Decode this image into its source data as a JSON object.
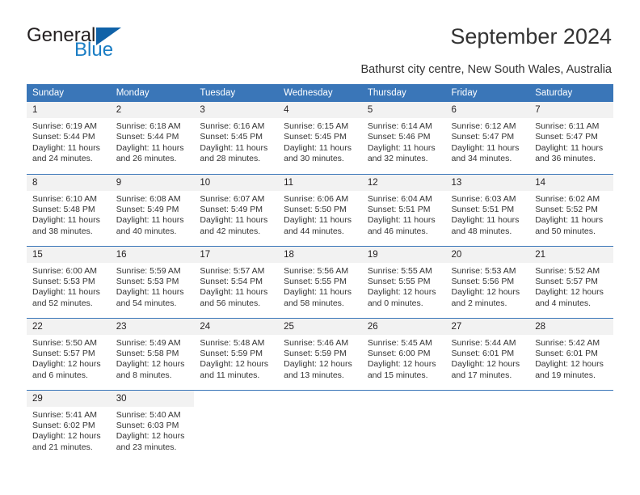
{
  "brand": {
    "name_top": "General",
    "name_bottom": "Blue",
    "accent_color": "#1062a8",
    "text_color": "#231f20"
  },
  "header": {
    "title": "September 2024",
    "location": "Bathurst city centre, New South Wales, Australia"
  },
  "theme": {
    "header_bg": "#3a76b8",
    "daynum_bg": "#f2f2f2",
    "body_text": "#333333"
  },
  "weekdays": [
    "Sunday",
    "Monday",
    "Tuesday",
    "Wednesday",
    "Thursday",
    "Friday",
    "Saturday"
  ],
  "weeks": [
    [
      {
        "day": "1",
        "sunrise": "Sunrise: 6:19 AM",
        "sunset": "Sunset: 5:44 PM",
        "daylight_l1": "Daylight: 11 hours",
        "daylight_l2": "and 24 minutes."
      },
      {
        "day": "2",
        "sunrise": "Sunrise: 6:18 AM",
        "sunset": "Sunset: 5:44 PM",
        "daylight_l1": "Daylight: 11 hours",
        "daylight_l2": "and 26 minutes."
      },
      {
        "day": "3",
        "sunrise": "Sunrise: 6:16 AM",
        "sunset": "Sunset: 5:45 PM",
        "daylight_l1": "Daylight: 11 hours",
        "daylight_l2": "and 28 minutes."
      },
      {
        "day": "4",
        "sunrise": "Sunrise: 6:15 AM",
        "sunset": "Sunset: 5:45 PM",
        "daylight_l1": "Daylight: 11 hours",
        "daylight_l2": "and 30 minutes."
      },
      {
        "day": "5",
        "sunrise": "Sunrise: 6:14 AM",
        "sunset": "Sunset: 5:46 PM",
        "daylight_l1": "Daylight: 11 hours",
        "daylight_l2": "and 32 minutes."
      },
      {
        "day": "6",
        "sunrise": "Sunrise: 6:12 AM",
        "sunset": "Sunset: 5:47 PM",
        "daylight_l1": "Daylight: 11 hours",
        "daylight_l2": "and 34 minutes."
      },
      {
        "day": "7",
        "sunrise": "Sunrise: 6:11 AM",
        "sunset": "Sunset: 5:47 PM",
        "daylight_l1": "Daylight: 11 hours",
        "daylight_l2": "and 36 minutes."
      }
    ],
    [
      {
        "day": "8",
        "sunrise": "Sunrise: 6:10 AM",
        "sunset": "Sunset: 5:48 PM",
        "daylight_l1": "Daylight: 11 hours",
        "daylight_l2": "and 38 minutes."
      },
      {
        "day": "9",
        "sunrise": "Sunrise: 6:08 AM",
        "sunset": "Sunset: 5:49 PM",
        "daylight_l1": "Daylight: 11 hours",
        "daylight_l2": "and 40 minutes."
      },
      {
        "day": "10",
        "sunrise": "Sunrise: 6:07 AM",
        "sunset": "Sunset: 5:49 PM",
        "daylight_l1": "Daylight: 11 hours",
        "daylight_l2": "and 42 minutes."
      },
      {
        "day": "11",
        "sunrise": "Sunrise: 6:06 AM",
        "sunset": "Sunset: 5:50 PM",
        "daylight_l1": "Daylight: 11 hours",
        "daylight_l2": "and 44 minutes."
      },
      {
        "day": "12",
        "sunrise": "Sunrise: 6:04 AM",
        "sunset": "Sunset: 5:51 PM",
        "daylight_l1": "Daylight: 11 hours",
        "daylight_l2": "and 46 minutes."
      },
      {
        "day": "13",
        "sunrise": "Sunrise: 6:03 AM",
        "sunset": "Sunset: 5:51 PM",
        "daylight_l1": "Daylight: 11 hours",
        "daylight_l2": "and 48 minutes."
      },
      {
        "day": "14",
        "sunrise": "Sunrise: 6:02 AM",
        "sunset": "Sunset: 5:52 PM",
        "daylight_l1": "Daylight: 11 hours",
        "daylight_l2": "and 50 minutes."
      }
    ],
    [
      {
        "day": "15",
        "sunrise": "Sunrise: 6:00 AM",
        "sunset": "Sunset: 5:53 PM",
        "daylight_l1": "Daylight: 11 hours",
        "daylight_l2": "and 52 minutes."
      },
      {
        "day": "16",
        "sunrise": "Sunrise: 5:59 AM",
        "sunset": "Sunset: 5:53 PM",
        "daylight_l1": "Daylight: 11 hours",
        "daylight_l2": "and 54 minutes."
      },
      {
        "day": "17",
        "sunrise": "Sunrise: 5:57 AM",
        "sunset": "Sunset: 5:54 PM",
        "daylight_l1": "Daylight: 11 hours",
        "daylight_l2": "and 56 minutes."
      },
      {
        "day": "18",
        "sunrise": "Sunrise: 5:56 AM",
        "sunset": "Sunset: 5:55 PM",
        "daylight_l1": "Daylight: 11 hours",
        "daylight_l2": "and 58 minutes."
      },
      {
        "day": "19",
        "sunrise": "Sunrise: 5:55 AM",
        "sunset": "Sunset: 5:55 PM",
        "daylight_l1": "Daylight: 12 hours",
        "daylight_l2": "and 0 minutes."
      },
      {
        "day": "20",
        "sunrise": "Sunrise: 5:53 AM",
        "sunset": "Sunset: 5:56 PM",
        "daylight_l1": "Daylight: 12 hours",
        "daylight_l2": "and 2 minutes."
      },
      {
        "day": "21",
        "sunrise": "Sunrise: 5:52 AM",
        "sunset": "Sunset: 5:57 PM",
        "daylight_l1": "Daylight: 12 hours",
        "daylight_l2": "and 4 minutes."
      }
    ],
    [
      {
        "day": "22",
        "sunrise": "Sunrise: 5:50 AM",
        "sunset": "Sunset: 5:57 PM",
        "daylight_l1": "Daylight: 12 hours",
        "daylight_l2": "and 6 minutes."
      },
      {
        "day": "23",
        "sunrise": "Sunrise: 5:49 AM",
        "sunset": "Sunset: 5:58 PM",
        "daylight_l1": "Daylight: 12 hours",
        "daylight_l2": "and 8 minutes."
      },
      {
        "day": "24",
        "sunrise": "Sunrise: 5:48 AM",
        "sunset": "Sunset: 5:59 PM",
        "daylight_l1": "Daylight: 12 hours",
        "daylight_l2": "and 11 minutes."
      },
      {
        "day": "25",
        "sunrise": "Sunrise: 5:46 AM",
        "sunset": "Sunset: 5:59 PM",
        "daylight_l1": "Daylight: 12 hours",
        "daylight_l2": "and 13 minutes."
      },
      {
        "day": "26",
        "sunrise": "Sunrise: 5:45 AM",
        "sunset": "Sunset: 6:00 PM",
        "daylight_l1": "Daylight: 12 hours",
        "daylight_l2": "and 15 minutes."
      },
      {
        "day": "27",
        "sunrise": "Sunrise: 5:44 AM",
        "sunset": "Sunset: 6:01 PM",
        "daylight_l1": "Daylight: 12 hours",
        "daylight_l2": "and 17 minutes."
      },
      {
        "day": "28",
        "sunrise": "Sunrise: 5:42 AM",
        "sunset": "Sunset: 6:01 PM",
        "daylight_l1": "Daylight: 12 hours",
        "daylight_l2": "and 19 minutes."
      }
    ],
    [
      {
        "day": "29",
        "sunrise": "Sunrise: 5:41 AM",
        "sunset": "Sunset: 6:02 PM",
        "daylight_l1": "Daylight: 12 hours",
        "daylight_l2": "and 21 minutes."
      },
      {
        "day": "30",
        "sunrise": "Sunrise: 5:40 AM",
        "sunset": "Sunset: 6:03 PM",
        "daylight_l1": "Daylight: 12 hours",
        "daylight_l2": "and 23 minutes."
      },
      {
        "day": "",
        "sunrise": "",
        "sunset": "",
        "daylight_l1": "",
        "daylight_l2": ""
      },
      {
        "day": "",
        "sunrise": "",
        "sunset": "",
        "daylight_l1": "",
        "daylight_l2": ""
      },
      {
        "day": "",
        "sunrise": "",
        "sunset": "",
        "daylight_l1": "",
        "daylight_l2": ""
      },
      {
        "day": "",
        "sunrise": "",
        "sunset": "",
        "daylight_l1": "",
        "daylight_l2": ""
      },
      {
        "day": "",
        "sunrise": "",
        "sunset": "",
        "daylight_l1": "",
        "daylight_l2": ""
      }
    ]
  ]
}
